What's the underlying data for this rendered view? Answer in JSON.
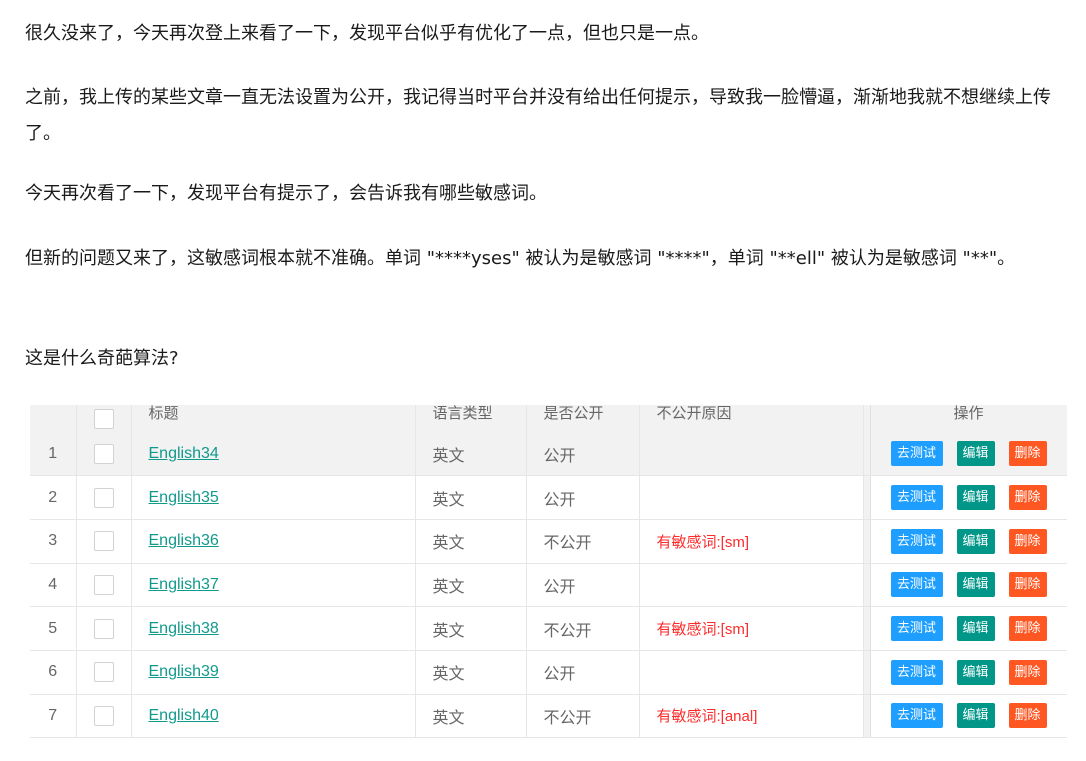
{
  "article": {
    "paragraphs": [
      "很久没来了，今天再次登上来看了一下，发现平台似乎有优化了一点，但也只是一点。",
      "之前，我上传的某些文章一直无法设置为公开，我记得当时平台并没有给出任何提示，导致我一脸懵逼，渐渐地我就不想继续上传了。",
      "今天再次看了一下，发现平台有提示了，会告诉我有哪些敏感词。",
      "但新的问题又来了，这敏感词根本就不准确。单词 \"****yses\" 被认为是敏感词 \"****\"，单词 \"**ell\" 被认为是敏感词 \"**\"。",
      "这是什么奇葩算法?"
    ]
  },
  "table": {
    "headers": {
      "title": "标题",
      "language": "语言类型",
      "public": "是否公开",
      "reason": "不公开原因",
      "ops": "操作"
    },
    "buttons": {
      "test": "去测试",
      "edit": "编辑",
      "delete": "删除"
    },
    "rows": [
      {
        "index": "1",
        "title": "English34",
        "language": "英文",
        "public": "公开",
        "reason": ""
      },
      {
        "index": "2",
        "title": "English35",
        "language": "英文",
        "public": "公开",
        "reason": ""
      },
      {
        "index": "3",
        "title": "English36",
        "language": "英文",
        "public": "不公开",
        "reason": "有敏感词:[sm]"
      },
      {
        "index": "4",
        "title": "English37",
        "language": "英文",
        "public": "公开",
        "reason": ""
      },
      {
        "index": "5",
        "title": "English38",
        "language": "英文",
        "public": "不公开",
        "reason": "有敏感词:[sm]"
      },
      {
        "index": "6",
        "title": "English39",
        "language": "英文",
        "public": "公开",
        "reason": ""
      },
      {
        "index": "7",
        "title": "English40",
        "language": "英文",
        "public": "不公开",
        "reason": "有敏感词:[anal]"
      }
    ],
    "highlighted_row": 0
  },
  "colors": {
    "link": "#119a8c",
    "reason": "#ff2a2a",
    "btn_test": "#1e9fff",
    "btn_edit": "#009688",
    "btn_delete": "#ff5722"
  }
}
